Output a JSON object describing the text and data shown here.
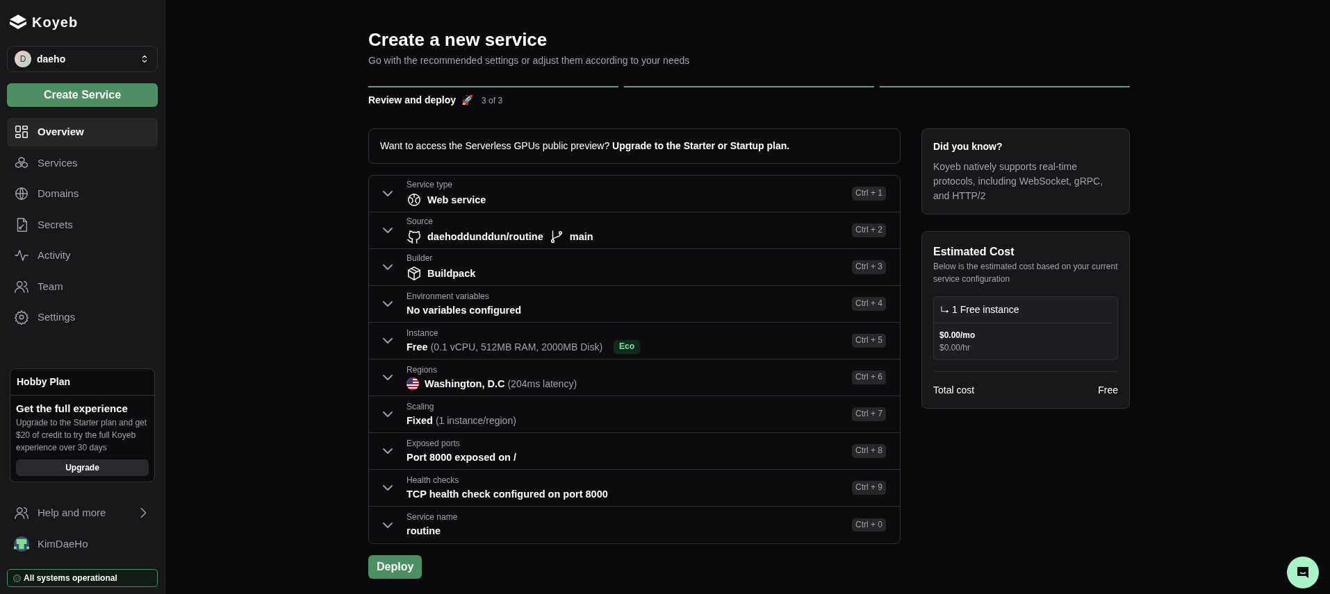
{
  "sidebar": {
    "logo": "Koyeb",
    "org": {
      "initial": "D",
      "name": "daeho"
    },
    "create_button": "Create Service",
    "items": [
      {
        "label": "Overview",
        "selected": true
      },
      {
        "label": "Services",
        "selected": false
      },
      {
        "label": "Domains",
        "selected": false
      },
      {
        "label": "Secrets",
        "selected": false
      },
      {
        "label": "Activity",
        "selected": false
      },
      {
        "label": "Team",
        "selected": false
      },
      {
        "label": "Settings",
        "selected": false
      }
    ],
    "plan_card": {
      "title": "Hobby Plan",
      "heading": "Get the full experience",
      "text": "Upgrade to the Starter plan and get $20 of credit to try the full Koyeb experience over 30 days",
      "button": "Upgrade"
    },
    "help": "Help and more",
    "user": "KimDaeHo",
    "status": "All systems operational"
  },
  "page": {
    "title": "Create a new service",
    "subtitle": "Go with the recommended settings or adjust them according to your needs",
    "steps": [
      {
        "completed": true
      },
      {
        "completed": true
      },
      {
        "completed": true
      }
    ],
    "step_label": "Review and deploy",
    "step_emoji": "🚀",
    "step_count": "3 of 3",
    "notice": "Want to access the Serverless GPUs public preview? **Upgrade to the Starter or Startup plan.**",
    "sections": [
      {
        "label": "Service type",
        "value": "Web service",
        "expanded": false,
        "shortcut": "Ctrl + 1"
      },
      {
        "label": "Source",
        "value": "daehoddunddun/routine",
        "branch": "main",
        "expanded": false,
        "shortcut": "Ctrl + 2"
      },
      {
        "label": "Builder",
        "value": "Buildpack",
        "expanded": false,
        "shortcut": "Ctrl + 3"
      },
      {
        "label": "Environment variables",
        "value": "No variables configured",
        "expanded": false,
        "shortcut": "Ctrl + 4"
      },
      {
        "label": "Instance",
        "value": "Free",
        "detail": "(0.1 vCPU, 512MB RAM, 2000MB Disk)",
        "badge": "Eco",
        "expanded": false,
        "shortcut": "Ctrl + 5"
      },
      {
        "label": "Regions",
        "value": "Washington, D.C",
        "detail": "(204ms latency)",
        "expanded": false,
        "shortcut": "Ctrl + 6"
      },
      {
        "label": "Scaling",
        "value": "Fixed",
        "detail": "(1 instance/region)",
        "expanded": false,
        "shortcut": "Ctrl + 7"
      },
      {
        "label": "Exposed ports",
        "value": "Port 8000 exposed on /",
        "expanded": false,
        "shortcut": "Ctrl + 8"
      },
      {
        "label": "Health checks",
        "value": "TCP health check configured on port 8000",
        "expanded": false,
        "shortcut": "Ctrl + 9"
      },
      {
        "label": "Service name",
        "value": "routine",
        "expanded": false,
        "shortcut": "Ctrl + 0"
      }
    ],
    "deploy_button": "Deploy"
  },
  "tip": {
    "title": "Did you know?",
    "text": "Koyeb natively supports real-time protocols, including WebSocket, gRPC, and HTTP/2"
  },
  "cost": {
    "title": "Estimated Cost",
    "subtitle": "Below is the estimated cost based on your current service configuration",
    "instance": "1 Free instance",
    "monthly": "$0.00/mo",
    "hourly": "$0.00/hr",
    "total_label": "Total cost",
    "total": "Free"
  }
}
